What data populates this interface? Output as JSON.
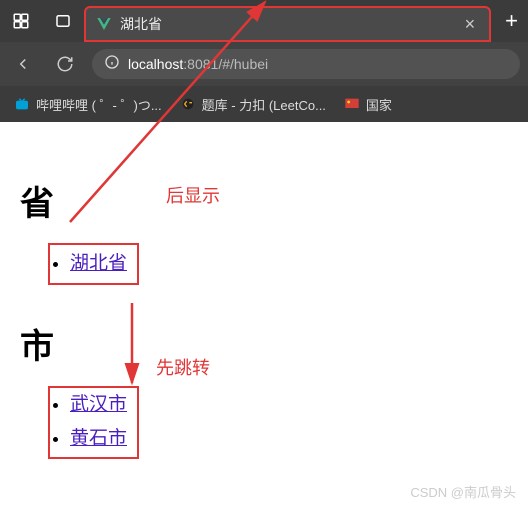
{
  "tab": {
    "title": "湖北省"
  },
  "url": {
    "host": "localhost",
    "port": ":8081",
    "path": "/#/hubei"
  },
  "bookmarks": [
    {
      "label": "哔哩哔哩 (  ゜- ゜)つ...",
      "icon_color": "#00a1d6"
    },
    {
      "label": "题库 - 力扣 (LeetCo...",
      "icon_color": "#f5a623"
    },
    {
      "label": "国家",
      "icon_color": "#d43f3a"
    }
  ],
  "headings": {
    "province": "省",
    "city": "市"
  },
  "links": {
    "province": "湖北省",
    "city1": "武汉市",
    "city2": "黄石市"
  },
  "annotations": {
    "after_show": "后显示",
    "first_jump": "先跳转"
  },
  "watermark": "CSDN @南瓜骨头"
}
